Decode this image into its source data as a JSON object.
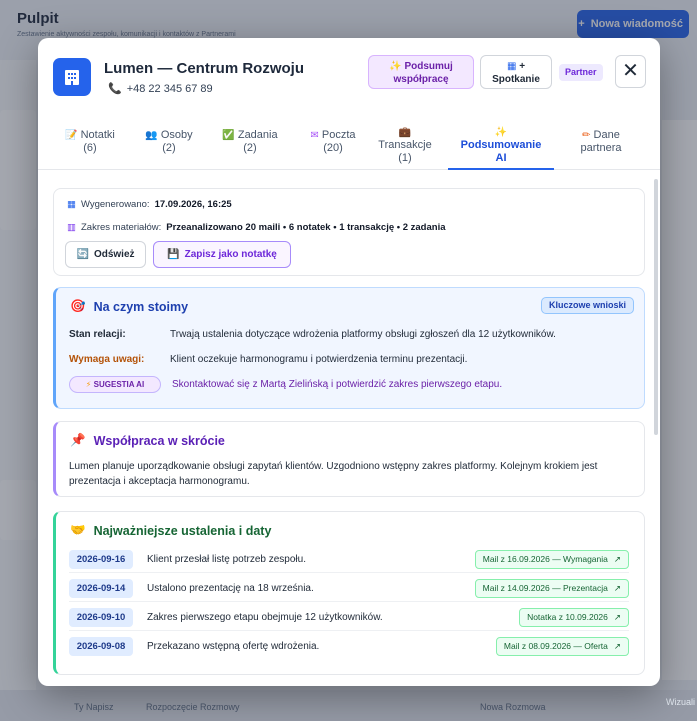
{
  "background": {
    "title": "Pulpit",
    "subtitle": "Zestawienie aktywności zespołu, komunikacji i kontaktów z Partnerami",
    "new_message_button": "Nowa wiadomość",
    "footer_left": "Ty Napisz",
    "footer_mid": "Rozpoczęcie Rozmowy",
    "footer_right": "Nowa Rozmowa",
    "watermark": "Wizuali"
  },
  "modal": {
    "company_name": "Lumen — Centrum Rozwoju",
    "phone": "+48 22 345 67 89",
    "summarize_button_line1": "Podsumuj",
    "summarize_button_line2": "współpracę",
    "meeting_button_line1": "+",
    "meeting_button_line2": "Spotkanie",
    "partner_badge": "Partner",
    "close_label": "✕"
  },
  "tabs": [
    {
      "label": "Notatki",
      "count": "(6)",
      "icon": "note-icon"
    },
    {
      "label": "Osoby",
      "count": "(2)",
      "icon": "people-icon"
    },
    {
      "label": "Zadania",
      "count": "(2)",
      "icon": "checkbox-icon"
    },
    {
      "label": "Poczta",
      "count": "(20)",
      "icon": "mail-icon"
    },
    {
      "label": "Transakcje",
      "count": "(1)",
      "icon": "briefcase-icon"
    },
    {
      "label": "Podsumowanie",
      "count": "AI",
      "icon": "sparkle-icon",
      "active": true
    },
    {
      "label": "Dane",
      "count": "partnera",
      "icon": "pencil-icon"
    }
  ],
  "generated": {
    "label": "Wygenerowano:",
    "value": "17.09.2026, 16:25",
    "scope_label": "Zakres materiałów:",
    "scope_value": "Przeanalizowano 20 maili • 6 notatek • 1 transakcję • 2 zadania",
    "refresh_button": "Odśwież",
    "save_button": "Zapisz jako notatkę"
  },
  "status_card": {
    "title": "Na czym stoimy",
    "badge": "Kluczowe wnioski",
    "relation_label": "Stan relacji:",
    "relation_value": "Trwają ustalenia dotyczące wdrożenia platformy obsługi zgłoszeń dla 12 użytkowników.",
    "attention_label": "Wymaga uwagi:",
    "attention_value": "Klient oczekuje harmonogramu i potwierdzenia terminu prezentacji.",
    "ai_badge": "SUGESTIA AI",
    "ai_value": "Skontaktować się z Martą Zielińską i potwierdzić zakres pierwszego etapu."
  },
  "summary_card": {
    "title": "Współpraca w skrócie",
    "text": "Lumen planuje uporządkowanie obsługi zapytań klientów. Uzgodniono wstępny zakres platformy. Kolejnym krokiem jest prezentacja i akceptacja harmonogramu."
  },
  "findings_card": {
    "title": "Najważniejsze ustalenia i daty",
    "items": [
      {
        "date": "2026-09-16",
        "text": "Klient przesłał listę potrzeb zespołu.",
        "source": "Mail z 16.09.2026 — Wymagania"
      },
      {
        "date": "2026-09-14",
        "text": "Ustalono prezentację na 18 września.",
        "source": "Mail z 14.09.2026 — Prezentacja"
      },
      {
        "date": "2026-09-10",
        "text": "Zakres pierwszego etapu obejmuje 12 użytkowników.",
        "source": "Notatka z 10.09.2026"
      },
      {
        "date": "2026-09-08",
        "text": "Przekazano wstępną ofertę wdrożenia.",
        "source": "Mail z 08.09.2026 — Oferta"
      }
    ]
  },
  "colors": {
    "accent": "#2563eb",
    "ai_purple": "#6b21a8",
    "warn": "#b45309",
    "success": "#166534"
  }
}
